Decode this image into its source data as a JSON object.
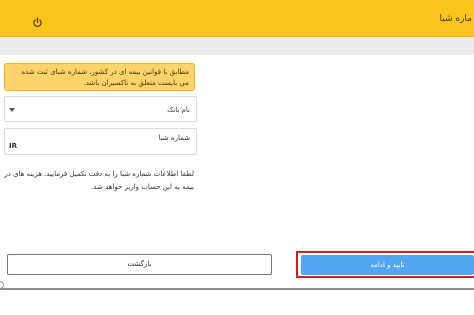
{
  "header": {
    "title": "ماره شبا",
    "power_icon": "power-icon"
  },
  "warning": {
    "text": "مطابق با قوانین بیمه ای در کشور، شماره شبای ثبت شده می بایست متعلق به تاکسیران باشد."
  },
  "form": {
    "bank_label": "نام بانک",
    "sheba_label": "شماره شبا",
    "sheba_prefix": "IR",
    "info_line1": "لطفا اطلاعات شماره شبا را به دقت تکمیل فرمایید. هزینه های دریافتی از",
    "info_line2": "بیمه به این حساب واریز خواهد شد."
  },
  "buttons": {
    "back_label": "بازگشت",
    "confirm_label": "تایید و ادامه"
  },
  "colors": {
    "header": "#f9c41c",
    "warning": "#fcd36a",
    "confirm": "#4ea7f0",
    "highlight": "#d21e1e"
  }
}
